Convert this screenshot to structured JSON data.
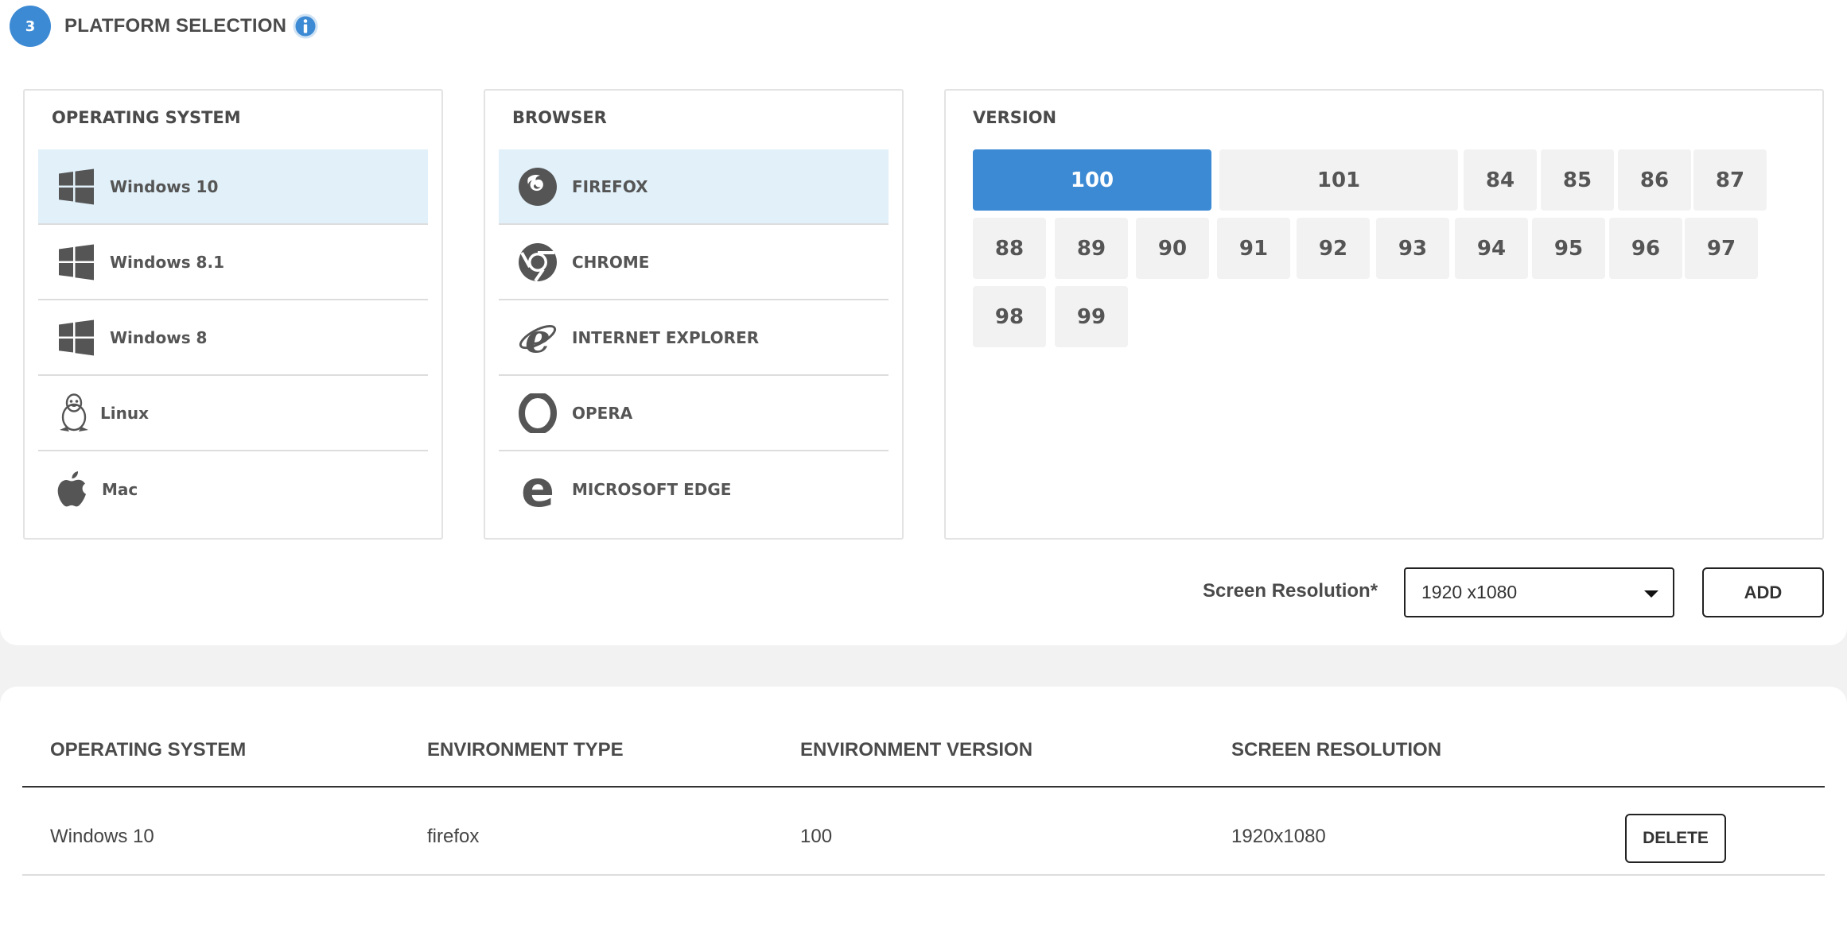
{
  "step": {
    "number": "3",
    "title": "PLATFORM SELECTION",
    "info_icon": "info-circle-icon"
  },
  "os_panel": {
    "title": "OPERATING SYSTEM",
    "items": [
      {
        "label": "Windows 10",
        "icon": "windows-icon",
        "selected": true
      },
      {
        "label": "Windows 8.1",
        "icon": "windows-icon",
        "selected": false
      },
      {
        "label": "Windows 8",
        "icon": "windows-icon",
        "selected": false
      },
      {
        "label": "Linux",
        "icon": "linux-tux-icon",
        "selected": false
      },
      {
        "label": "Mac",
        "icon": "apple-icon",
        "selected": false
      }
    ]
  },
  "browser_panel": {
    "title": "BROWSER",
    "items": [
      {
        "label": "FIREFOX",
        "icon": "firefox-icon",
        "selected": true
      },
      {
        "label": "CHROME",
        "icon": "chrome-icon",
        "selected": false
      },
      {
        "label": "INTERNET EXPLORER",
        "icon": "internet-explorer-icon",
        "selected": false
      },
      {
        "label": "OPERA",
        "icon": "opera-icon",
        "selected": false
      },
      {
        "label": "MICROSOFT EDGE",
        "icon": "edge-icon",
        "selected": false
      }
    ]
  },
  "version_panel": {
    "title": "VERSION",
    "versions": [
      "100",
      "101",
      "84",
      "85",
      "86",
      "87",
      "88",
      "89",
      "90",
      "91",
      "92",
      "93",
      "94",
      "95",
      "96",
      "97",
      "98",
      "99"
    ],
    "selected": "100"
  },
  "resolution": {
    "label": "Screen Resolution*",
    "value": "1920 x1080",
    "add_label": "ADD"
  },
  "table": {
    "headers": [
      "OPERATING SYSTEM",
      "ENVIRONMENT TYPE",
      "ENVIRONMENT VERSION",
      "SCREEN RESOLUTION"
    ],
    "rows": [
      {
        "os": "Windows 10",
        "type": "firefox",
        "version": "100",
        "resolution": "1920x1080",
        "delete_label": "DELETE"
      }
    ]
  },
  "colors": {
    "accent": "#3d8ad4",
    "selected_row": "#e1f0f9",
    "version_bg": "#f2f2f2",
    "icon": "#555555"
  }
}
